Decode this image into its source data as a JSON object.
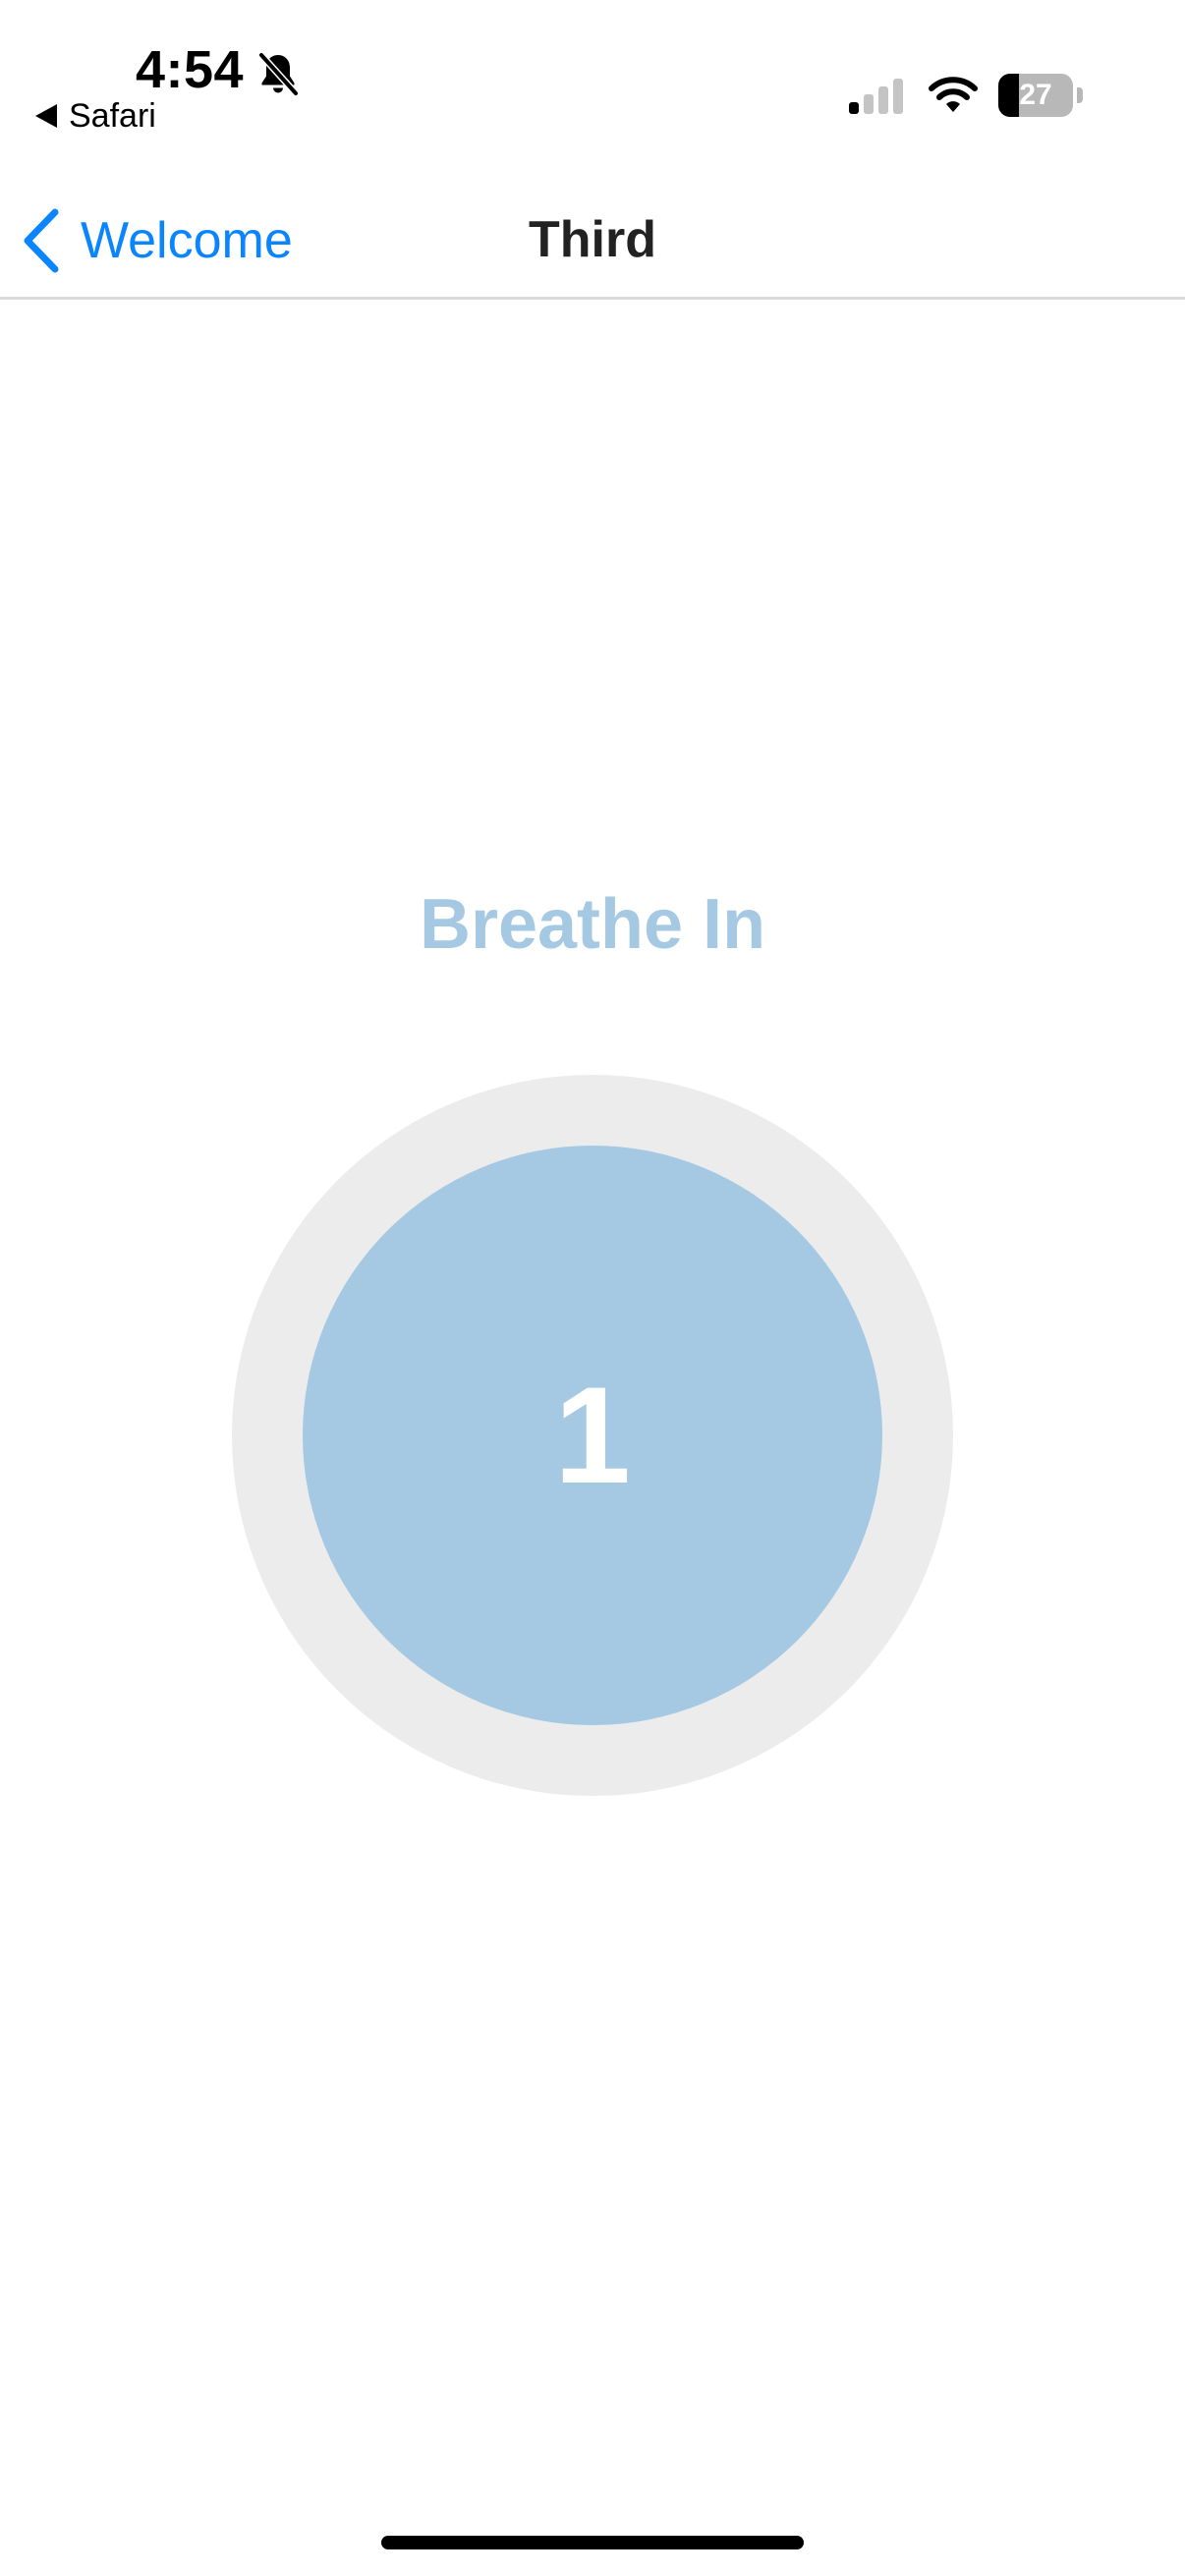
{
  "status_bar": {
    "time": "4:54",
    "back_app_label": "Safari",
    "battery_level": "27",
    "battery_fraction": 0.27,
    "bell_icon": "bell-slash-icon",
    "signal_icon": "cellular-signal-icon",
    "wifi_icon": "wifi-icon"
  },
  "nav": {
    "back_label": "Welcome",
    "title": "Third",
    "accent_color": "#0a84ff"
  },
  "exercise": {
    "phase_label": "Breathe In",
    "count": "1",
    "circle_color": "#a6c9e3",
    "ring_color": "#ececec"
  }
}
